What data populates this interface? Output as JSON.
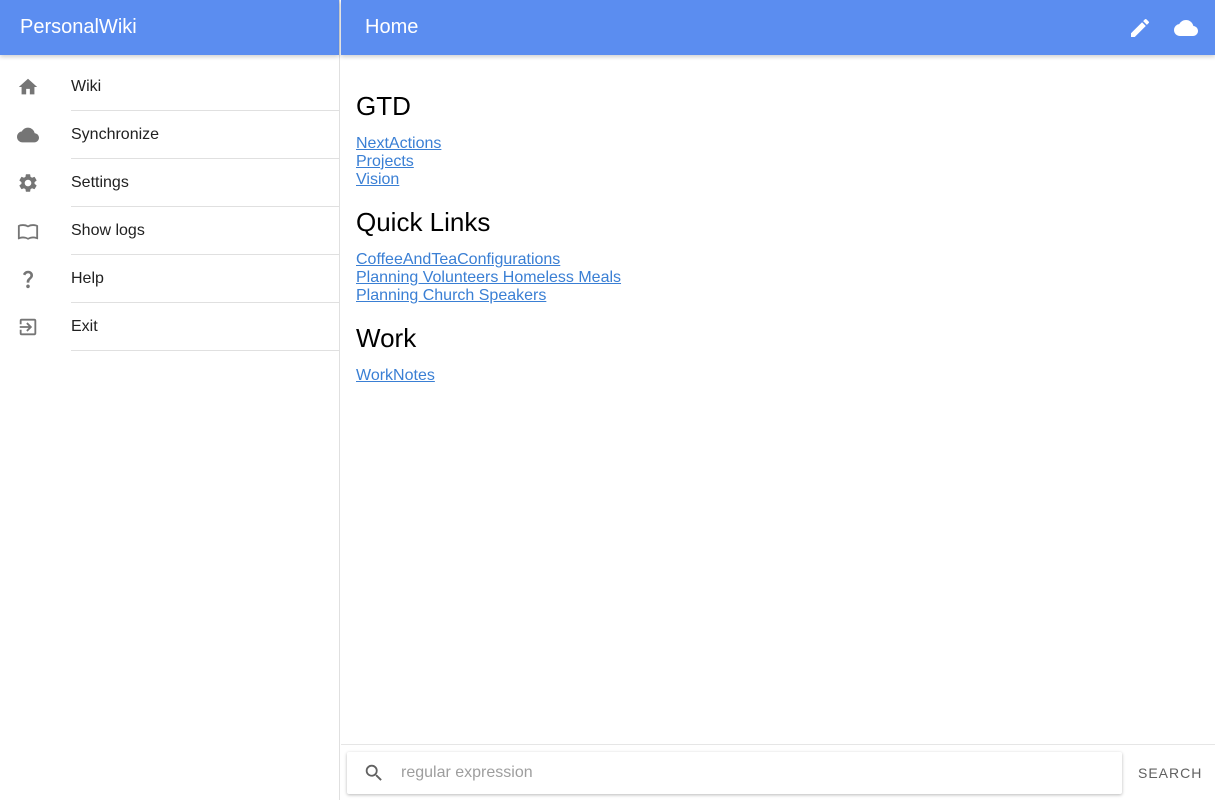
{
  "app": {
    "title": "PersonalWiki"
  },
  "sidebar": {
    "items": [
      {
        "label": "Wiki",
        "icon": "home-icon"
      },
      {
        "label": "Synchronize",
        "icon": "cloud-icon"
      },
      {
        "label": "Settings",
        "icon": "gear-icon"
      },
      {
        "label": "Show logs",
        "icon": "book-icon"
      },
      {
        "label": "Help",
        "icon": "question-icon"
      },
      {
        "label": "Exit",
        "icon": "exit-icon"
      }
    ]
  },
  "header": {
    "title": "Home",
    "actions": [
      {
        "name": "edit",
        "icon": "pencil-icon"
      },
      {
        "name": "sync",
        "icon": "cloud-icon"
      }
    ]
  },
  "content": {
    "sections": [
      {
        "heading": "GTD",
        "links": [
          "NextActions",
          "Projects",
          "Vision"
        ]
      },
      {
        "heading": "Quick Links",
        "links": [
          "CoffeeAndTeaConfigurations",
          "Planning Volunteers Homeless Meals",
          "Planning Church Speakers"
        ]
      },
      {
        "heading": "Work",
        "links": [
          "WorkNotes"
        ]
      }
    ]
  },
  "search": {
    "placeholder": "regular expression",
    "value": "",
    "button_label": "SEARCH"
  },
  "colors": {
    "header_bg": "#5b8df0",
    "link": "#3a7fd4",
    "icon": "#757575"
  }
}
